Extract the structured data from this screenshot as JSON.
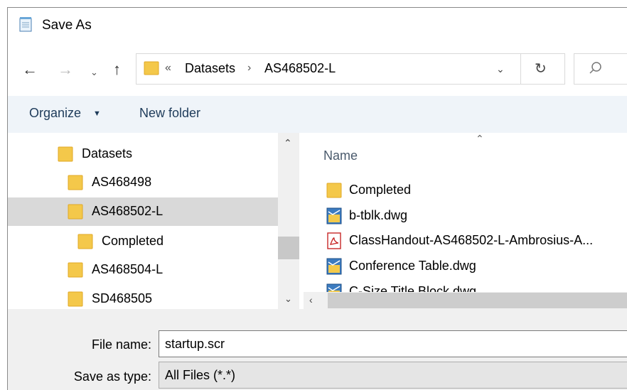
{
  "window": {
    "title": "Save As"
  },
  "nav": {
    "back_glyph": "←",
    "forward_glyph": "→",
    "recent_glyph": "⌄",
    "up_glyph": "↑"
  },
  "address": {
    "overflow_glyph": "«",
    "segments": [
      "Datasets",
      "AS468502-L"
    ],
    "separator_glyph": "›",
    "dropdown_glyph": "⌄",
    "refresh_glyph": "↻"
  },
  "toolbar": {
    "organize_label": "Organize",
    "organize_arrow": "▼",
    "new_folder_label": "New folder"
  },
  "tree": {
    "items": [
      {
        "label": "Datasets",
        "selected": false
      },
      {
        "label": "AS468498",
        "selected": false
      },
      {
        "label": "AS468502-L",
        "selected": true
      },
      {
        "label": "Completed",
        "selected": false
      },
      {
        "label": "AS468504-L",
        "selected": false
      },
      {
        "label": "SD468505",
        "selected": false
      }
    ],
    "scroll_up_glyph": "⌃",
    "scroll_down_glyph": "⌄"
  },
  "list": {
    "sort_glyph": "⌃",
    "column_name": "Name",
    "files": [
      {
        "label": "Completed",
        "icon": "folder-icon"
      },
      {
        "label": "b-tblk.dwg",
        "icon": "dwg-file-icon"
      },
      {
        "label": "ClassHandout-AS468502-L-Ambrosius-A...",
        "icon": "pdf-file-icon"
      },
      {
        "label": "Conference Table.dwg",
        "icon": "dwg-file-icon"
      },
      {
        "label": "C-Size Title Block.dwg",
        "icon": "dwg-file-icon"
      }
    ],
    "hscroll_left_glyph": "‹"
  },
  "form": {
    "file_name_label": "File name:",
    "file_name_value": "startup.scr",
    "save_type_label": "Save as type:",
    "save_type_value": "All Files (*.*)"
  },
  "colors": {
    "folder": "#f4c84a",
    "folder_dark": "#e0a826",
    "selection": "#d9d9d9",
    "toolbar_bg": "#eff4f9",
    "toolbar_text": "#1e3b5a"
  }
}
